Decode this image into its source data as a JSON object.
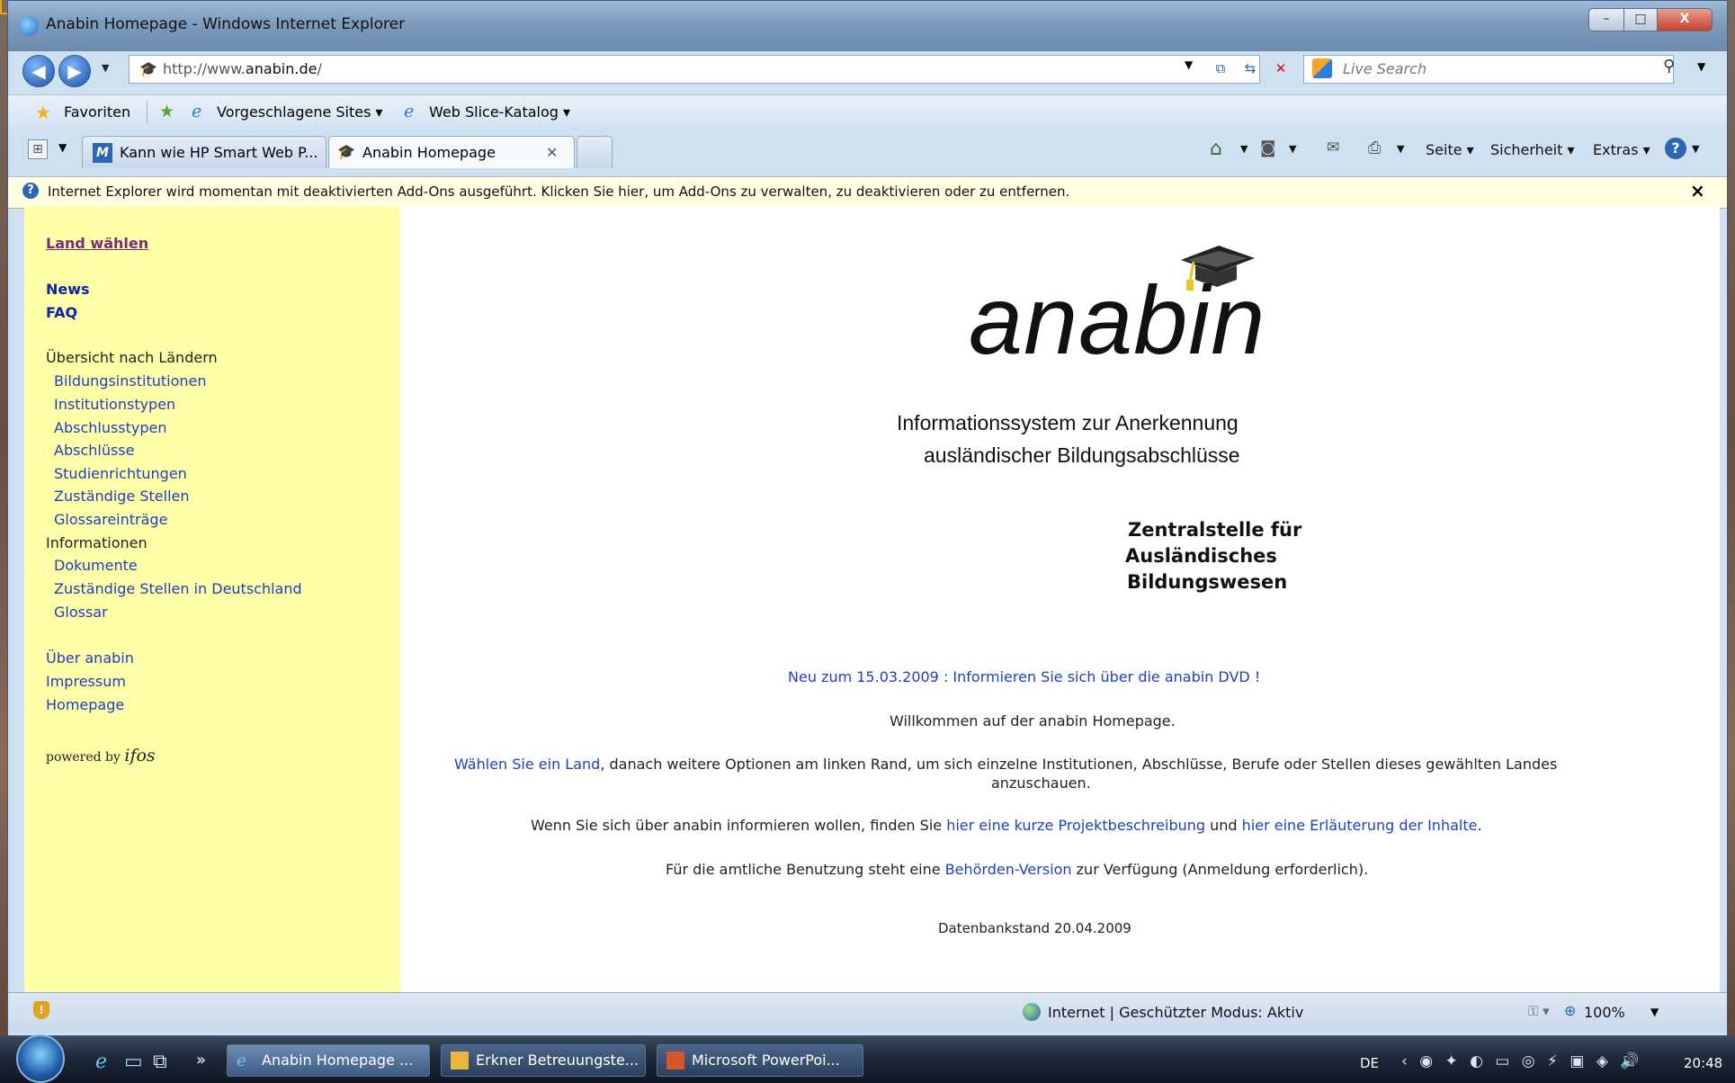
{
  "window": {
    "title": "Anabin Homepage - Windows Internet Explorer",
    "controls": {
      "minimize": "–",
      "maximize": "□",
      "close": "X"
    }
  },
  "address_bar": {
    "url_prefix": "http://www.",
    "url_domain": "anabin.de",
    "url_suffix": "/",
    "search_placeholder": "Live Search"
  },
  "favorites_bar": {
    "favorites": "Favoriten",
    "suggested_sites": "Vorgeschlagene Sites ▾",
    "web_slice": "Web Slice-Katalog ▾"
  },
  "tabs": [
    {
      "label": "Kann wie HP Smart Web P...",
      "active": false
    },
    {
      "label": "Anabin Homepage",
      "active": true
    }
  ],
  "command_bar": {
    "page": "Seite ▾",
    "safety": "Sicherheit ▾",
    "tools": "Extras ▾"
  },
  "info_bar": {
    "text": "Internet Explorer wird momentan mit deaktivierten Add-Ons ausgeführt. Klicken Sie hier, um Add-Ons zu verwalten, zu deaktivieren oder zu entfernen.",
    "close": "×"
  },
  "sidebar": {
    "choose_country": "Land wählen",
    "news": "News",
    "faq": "FAQ",
    "overview_heading": "Übersicht nach Ländern",
    "overview_items": [
      "Bildungsinstitutionen",
      "Institutionstypen",
      "Abschlusstypen",
      "Abschlüsse",
      "Studienrichtungen",
      "Zuständige Stellen",
      "Glossareinträge"
    ],
    "info_heading": "Informationen",
    "info_items": [
      "Dokumente",
      "Zuständige Stellen in Deutschland",
      "Glossar"
    ],
    "about": "Über anabin",
    "imprint": "Impressum",
    "homepage": "Homepage",
    "powered_by": "powered by",
    "powered_brand": "ifos"
  },
  "main": {
    "logo": "anabin",
    "subtitle_line1": "Informationssystem zur Anerkennung",
    "subtitle_line2": "ausländischer Bildungsabschlüsse",
    "zab_line1": "Zentralstelle für",
    "zab_line2": "Ausländisches",
    "zab_line3": "Bildungswesen",
    "news_link": "Neu zum 15.03.2009 : Informieren Sie sich über die anabin DVD !",
    "welcome": "Willkommen auf der anabin Homepage.",
    "choose_link": "Wählen Sie ein Land",
    "choose_rest": ", danach weitere Optionen am linken Rand, um sich einzelne Institutionen, Abschlüsse, Berufe oder Stellen dieses gewählten Landes",
    "choose_rest2": "anzuschauen.",
    "info_pre": "Wenn Sie sich über anabin informieren wollen, finden Sie ",
    "info_link1": "hier eine kurze Projektbeschreibung",
    "info_mid": " und ",
    "info_link2": "hier eine Erläuterung der Inhalte",
    "info_post": ".",
    "official_pre": "Für die amtliche Benutzung steht eine ",
    "official_link": "Behörden-Version",
    "official_post": " zur Verfügung (Anmeldung erforderlich).",
    "db_state": "Datenbankstand 20.04.2009"
  },
  "status_bar": {
    "zone": "Internet | Geschützter Modus: Aktiv",
    "zoom": "100%"
  },
  "taskbar": {
    "items": [
      "Anabin Homepage ...",
      "Erkner Betreuungste...",
      "Microsoft PowerPoi..."
    ],
    "chevron": "»",
    "language": "DE",
    "clock": "20:48"
  }
}
